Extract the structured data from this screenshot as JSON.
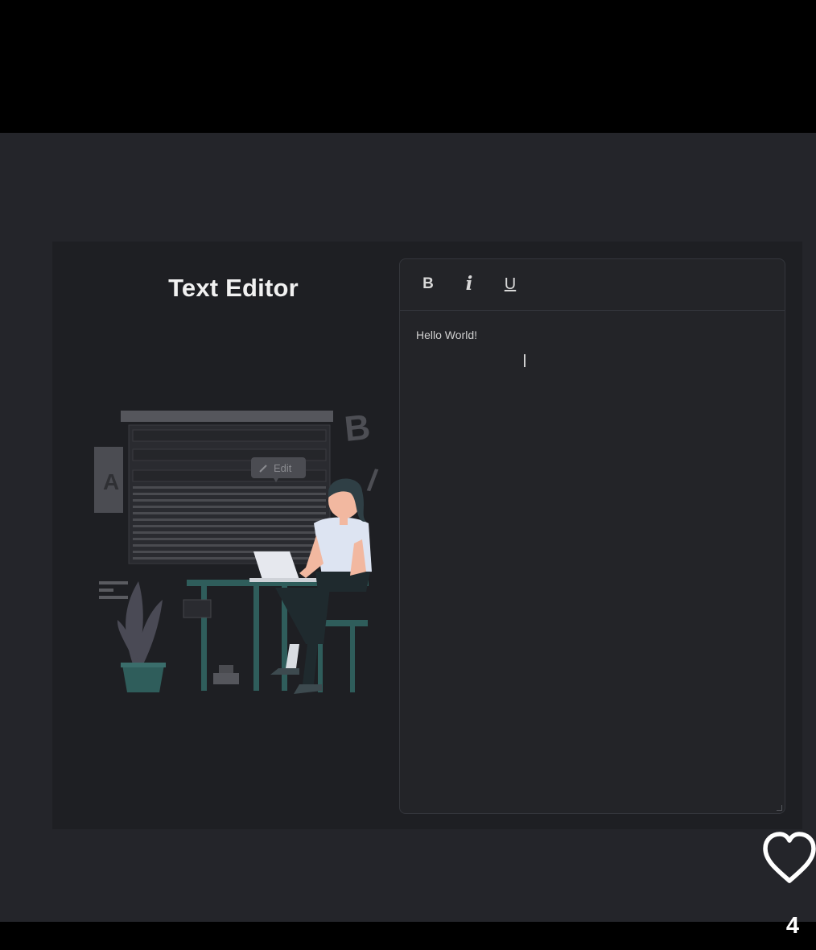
{
  "title": "Text Editor",
  "toolbar": {
    "bold_label": "B",
    "italic_label": "i",
    "underline_label": "U"
  },
  "editor": {
    "content": "Hello World!"
  },
  "illustration": {
    "edit_badge": "Edit",
    "big_letter": "B",
    "slash_letter": "/",
    "side_letter": "A"
  },
  "like": {
    "count": "4",
    "icon": "heart-icon"
  },
  "colors": {
    "background": "#24252a",
    "card": "#1e1f23",
    "editor": "#232428",
    "accent_teal": "#2f5d5b"
  }
}
